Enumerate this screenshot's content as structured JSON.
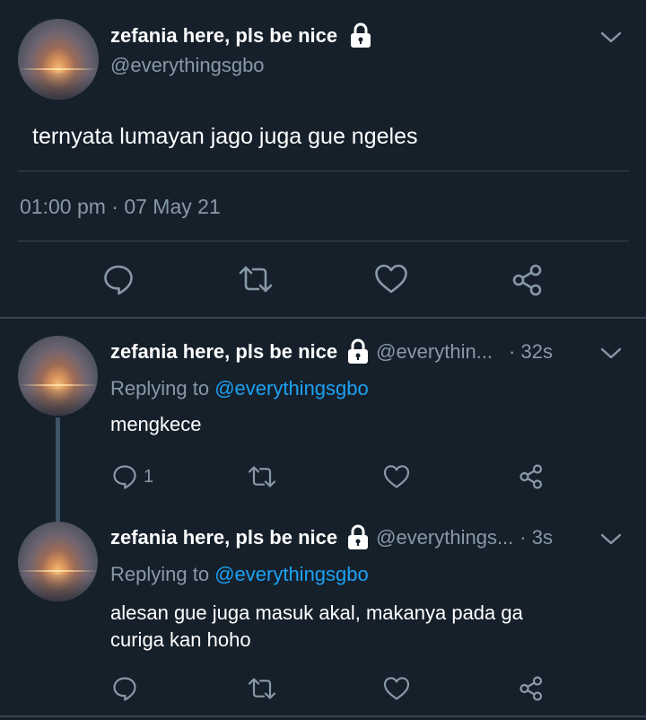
{
  "main_tweet": {
    "display_name": "zefania here, pls be nice",
    "handle": "@everythingsgbo",
    "text": "ternyata lumayan jago juga gue ngeles",
    "timestamp": "01:00 pm · 07 May 21",
    "icons": [
      "lock-icon",
      "chevron-down-icon",
      "reply-icon",
      "retweet-icon",
      "like-icon",
      "share-icon"
    ]
  },
  "replies": [
    {
      "display_name": "zefania here, pls be nice",
      "handle_truncated": "@everythin...",
      "age": "· 32s",
      "replying_prefix": "Replying to",
      "replying_handle": "@everythingsgbo",
      "text": "mengkece",
      "reply_count": "1"
    },
    {
      "display_name": "zefania here, pls be nice",
      "handle_truncated": "@everythings...",
      "age": "· 3s",
      "replying_prefix": "Replying to",
      "replying_handle": "@everythingsgbo",
      "text_line1": "alesan gue juga masuk akal, makanya pada ga",
      "text_line2": "curiga kan hoho"
    }
  ],
  "colors": {
    "background": "#15202b",
    "text": "#ffffff",
    "muted": "#8899a6",
    "link": "#1da1f2",
    "divider": "#38444d"
  }
}
